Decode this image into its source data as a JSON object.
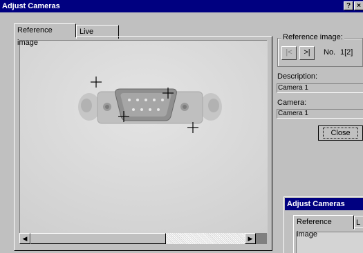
{
  "window": {
    "title": "Adjust Cameras",
    "help_btn": "?",
    "close_btn": "×"
  },
  "tabs": [
    {
      "label": "Reference image",
      "active": true
    },
    {
      "label": "Live image",
      "active": false
    }
  ],
  "image": {
    "description": "Grayscale photo of a 9-pin D-sub connector with four calibration cross markers"
  },
  "reference_group": {
    "label": "Reference image:",
    "first_icon": "skip-first-icon",
    "last_icon": "skip-last-icon",
    "no_label": "No.",
    "no_value": "1[2]"
  },
  "description": {
    "label": "Description:",
    "value": "Camera 1"
  },
  "camera": {
    "label": "Camera:",
    "value": "Camera 1"
  },
  "close_label": "Close",
  "subwindow": {
    "title": "Adjust Cameras",
    "tab1": "Reference image",
    "tab2": "L"
  },
  "colors": {
    "titlebar": "#000080",
    "face": "#c0c0c0",
    "image_bg": "#dadada"
  }
}
